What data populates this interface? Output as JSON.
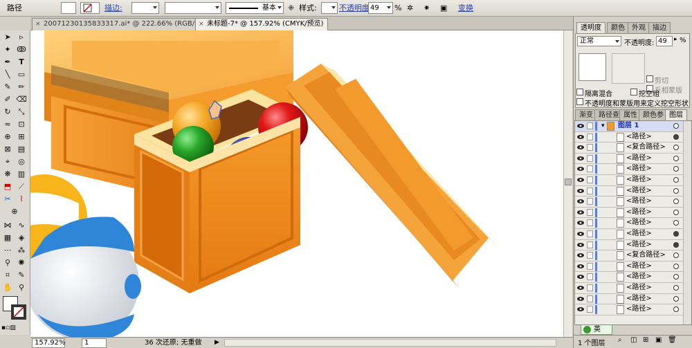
{
  "control_bar": {
    "object_type": "路径",
    "stroke_label": "描边:",
    "stroke_profile": "基本",
    "style_label": "样式:",
    "opacity_label": "不透明度",
    "opacity_value": "49",
    "opacity_unit": "%",
    "transform_label": "变换"
  },
  "doc_tabs": [
    {
      "label": "20071230135833317.ai* @ 222.66% (RGB/预览)"
    },
    {
      "label": "未标题-7* @ 157.92% (CMYK/预览)"
    }
  ],
  "status_bar": {
    "zoom": "157.92%",
    "artboard": "1",
    "message": "36 次还原; 无重做"
  },
  "transparency_panel": {
    "tabs": [
      "透明度",
      "颜色",
      "外观",
      "描边"
    ],
    "blend_mode": "正常",
    "opacity_label": "不透明度:",
    "opacity_value": "49",
    "opacity_unit": "%",
    "clip_label": "剪切",
    "invert_mask_label": "反相蒙版",
    "isolate_blending_label": "隔离混合",
    "knockout_group_label": "挖空组",
    "opacity_mask_label": "不透明度和蒙版用来定义挖空形状"
  },
  "layers_panel": {
    "tabs": [
      "渐变",
      "路径查",
      "属性",
      "颜色参",
      "图层"
    ],
    "rows": [
      {
        "name": "图层 1",
        "is_layer": true,
        "target": "open"
      },
      {
        "name": "<路径>",
        "target": "filled"
      },
      {
        "name": "<复合路径>",
        "target": "open"
      },
      {
        "name": "<路径>",
        "target": "open"
      },
      {
        "name": "<路径>",
        "target": "open"
      },
      {
        "name": "<路径>",
        "target": "open"
      },
      {
        "name": "<路径>",
        "target": "open"
      },
      {
        "name": "<路径>",
        "target": "open"
      },
      {
        "name": "<路径>",
        "target": "open"
      },
      {
        "name": "<路径>",
        "target": "open"
      },
      {
        "name": "<路径>",
        "target": "filled"
      },
      {
        "name": "<路径>",
        "target": "filled"
      },
      {
        "name": "<复合路径>",
        "target": "open"
      },
      {
        "name": "<路径>",
        "target": "open"
      },
      {
        "name": "<路径>",
        "target": "open"
      },
      {
        "name": "<路径>",
        "target": "open"
      },
      {
        "name": "<路径>",
        "target": "open"
      },
      {
        "name": "<路径>",
        "target": "open"
      }
    ],
    "footer_label": "1 个图层"
  },
  "ime": {
    "label": "英"
  },
  "colors": {
    "accent_link": "#2a3fb3",
    "layer_color": "#5b7bd6"
  }
}
